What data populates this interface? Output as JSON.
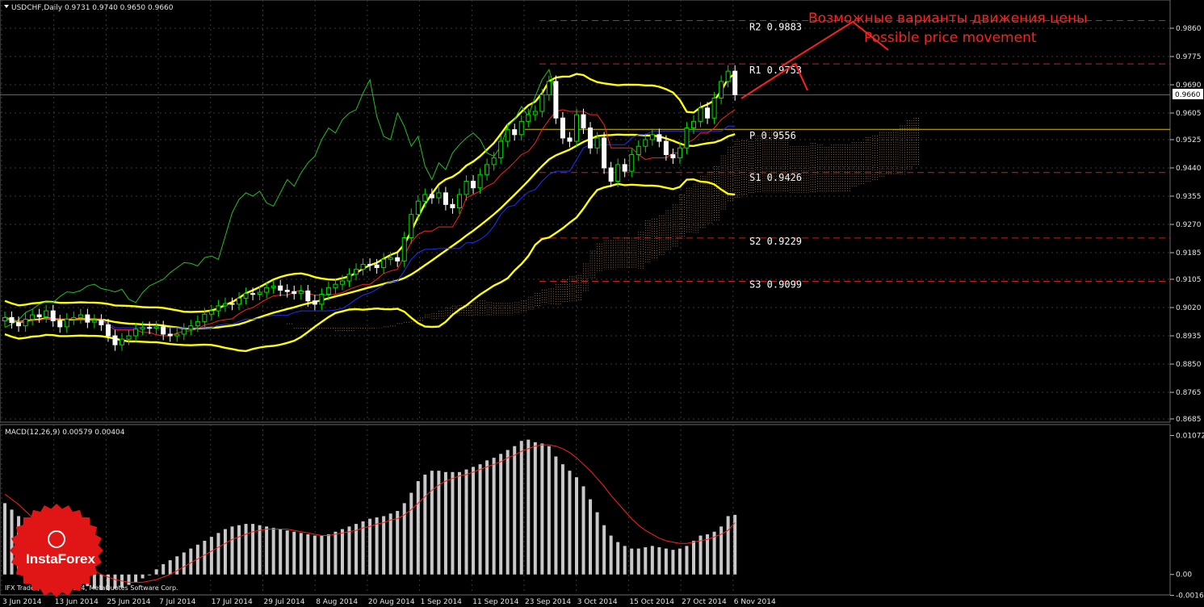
{
  "chart_data": [
    {
      "type": "candlestick",
      "symbol_header": "USDCHF,Daily  0.9731 0.9740 0.9650 0.9660",
      "current_price": "0.9660",
      "y_ticks": [
        "0.9860",
        "0.9775",
        "0.9690",
        "0.9605",
        "0.9525",
        "0.9440",
        "0.9355",
        "0.9270",
        "0.9185",
        "0.9105",
        "0.9020",
        "0.8935",
        "0.8850",
        "0.8765",
        "0.8685"
      ],
      "ylim": [
        0.868,
        0.9895
      ],
      "x_labels": [
        "3 Jun 2014",
        "13 Jun 2014",
        "25 Jun 2014",
        "7 Jul 2014",
        "17 Jul 2014",
        "29 Jul 2014",
        "8 Aug 2014",
        "20 Aug 2014",
        "1 Sep 2014",
        "11 Sep 2014",
        "23 Sep 2014",
        "3 Oct 2014",
        "15 Oct 2014",
        "27 Oct 2014",
        "6 Nov 2014"
      ],
      "pivot_levels": [
        {
          "name": "R2",
          "value": 0.9883,
          "label": "R2  0.9883"
        },
        {
          "name": "R1",
          "value": 0.9753,
          "label": "R1  0.9753"
        },
        {
          "name": "P",
          "value": 0.9556,
          "label": "P  0.9556"
        },
        {
          "name": "S1",
          "value": 0.9426,
          "label": "S1  0.9426"
        },
        {
          "name": "S2",
          "value": 0.9229,
          "label": "S2  0.9229"
        },
        {
          "name": "S3",
          "value": 0.9099,
          "label": "S3  0.9099"
        }
      ],
      "annotation_ru": "Возможные варианты движения цены",
      "annotation_en": "Possible price movement",
      "colors": {
        "bull": "#00dd00",
        "bear": "#ffffff",
        "bollinger": "#ffff00",
        "tenkan": "#ff2020",
        "kijun": "#2030ff",
        "chikou": "#20c020",
        "cloud": "#c89060",
        "pivot": "#c82020",
        "pivot_p": "#d8c000",
        "arrow": "#ff2020"
      },
      "closes": [
        0.899,
        0.8975,
        0.8965,
        0.8985,
        0.8998,
        0.8992,
        0.901,
        0.898,
        0.8962,
        0.8985,
        0.899,
        0.8998,
        0.8976,
        0.8982,
        0.8968,
        0.8935,
        0.8908,
        0.8925,
        0.8935,
        0.8955,
        0.896,
        0.8958,
        0.8962,
        0.894,
        0.8935,
        0.894,
        0.8955,
        0.8965,
        0.8978,
        0.9,
        0.901,
        0.9025,
        0.9032,
        0.903,
        0.9048,
        0.9062,
        0.906,
        0.9066,
        0.908,
        0.9085,
        0.9072,
        0.9068,
        0.9062,
        0.907,
        0.904,
        0.903,
        0.906,
        0.908,
        0.909,
        0.91,
        0.912,
        0.9135,
        0.915,
        0.9148,
        0.914,
        0.9165,
        0.917,
        0.916,
        0.923,
        0.93,
        0.934,
        0.936,
        0.935,
        0.9365,
        0.933,
        0.932,
        0.936,
        0.94,
        0.938,
        0.942,
        0.945,
        0.947,
        0.952,
        0.9555,
        0.954,
        0.958,
        0.96,
        0.961,
        0.966,
        0.97,
        0.959,
        0.953,
        0.952,
        0.96,
        0.956,
        0.95,
        0.953,
        0.944,
        0.94,
        0.945,
        0.943,
        0.948,
        0.9505,
        0.9525,
        0.954,
        0.952,
        0.948,
        0.947,
        0.95,
        0.956,
        0.958,
        0.962,
        0.959,
        0.965,
        0.97,
        0.9731,
        0.966
      ],
      "macd": {
        "label": "MACD(12,26,9) 0.00579 0.00404",
        "ylim": [
          -0.0012,
          0.011
        ],
        "y_ticks": [
          "0.01072",
          "0.00",
          "-0.00161"
        ],
        "values": [
          0.0055,
          0.005,
          0.0045,
          0.004,
          0.0033,
          0.0027,
          0.002,
          0.0014,
          0.0008,
          0.0003,
          -0.0001,
          -0.0005,
          -0.0009,
          -0.0011,
          -0.0012,
          -0.0012,
          -0.0011,
          -0.001,
          -0.0008,
          -0.0006,
          -0.0003,
          0.0,
          0.0004,
          0.0008,
          0.0011,
          0.0014,
          0.0017,
          0.002,
          0.0023,
          0.0026,
          0.0029,
          0.0032,
          0.0035,
          0.0037,
          0.0038,
          0.0039,
          0.0039,
          0.0038,
          0.0037,
          0.0036,
          0.0035,
          0.0034,
          0.0033,
          0.0032,
          0.0031,
          0.003,
          0.003,
          0.0031,
          0.0033,
          0.0035,
          0.0037,
          0.0039,
          0.0041,
          0.0043,
          0.0044,
          0.0045,
          0.0047,
          0.0049,
          0.0055,
          0.0063,
          0.0072,
          0.0077,
          0.008,
          0.008,
          0.0079,
          0.0079,
          0.0079,
          0.0081,
          0.0083,
          0.0085,
          0.0088,
          0.009,
          0.0093,
          0.0096,
          0.0099,
          0.0103,
          0.0104,
          0.0102,
          0.0101,
          0.0099,
          0.0091,
          0.0085,
          0.008,
          0.0075,
          0.0068,
          0.0058,
          0.0048,
          0.0038,
          0.003,
          0.0025,
          0.0022,
          0.002,
          0.002,
          0.0021,
          0.0022,
          0.0021,
          0.002,
          0.0019,
          0.002,
          0.0022,
          0.0026,
          0.003,
          0.0031,
          0.0033,
          0.0037,
          0.0045,
          0.0046
        ],
        "signal": [
          0.0062,
          0.0058,
          0.0054,
          0.0049,
          0.0044,
          0.0039,
          0.0033,
          0.0028,
          0.0023,
          0.0018,
          0.0014,
          0.001,
          0.0006,
          0.0003,
          0.0,
          -0.0002,
          -0.0004,
          -0.0005,
          -0.0006,
          -0.0006,
          -0.0006,
          -0.0005,
          -0.0004,
          -0.0002,
          0.0,
          0.0003,
          0.0006,
          0.0009,
          0.0012,
          0.0015,
          0.0018,
          0.0021,
          0.0024,
          0.0027,
          0.0029,
          0.0031,
          0.0033,
          0.0034,
          0.0035,
          0.0035,
          0.0035,
          0.0035,
          0.0034,
          0.0033,
          0.0032,
          0.0031,
          0.003,
          0.003,
          0.0031,
          0.0032,
          0.0033,
          0.0034,
          0.0036,
          0.0037,
          0.0039,
          0.004,
          0.0042,
          0.0043,
          0.0046,
          0.005,
          0.0055,
          0.006,
          0.0065,
          0.0069,
          0.0072,
          0.0074,
          0.0076,
          0.0077,
          0.0079,
          0.0081,
          0.0083,
          0.0085,
          0.0087,
          0.009,
          0.0092,
          0.0095,
          0.0097,
          0.0099,
          0.01,
          0.01,
          0.0099,
          0.0097,
          0.0094,
          0.009,
          0.0085,
          0.008,
          0.0074,
          0.0068,
          0.0061,
          0.0055,
          0.0049,
          0.0043,
          0.0038,
          0.0034,
          0.0031,
          0.0028,
          0.0026,
          0.0025,
          0.0024,
          0.0024,
          0.0025,
          0.0026,
          0.0027,
          0.0029,
          0.0031,
          0.0034,
          0.004
        ]
      },
      "footer": "IFX Trader, © 2001-2014, MetaQuotes Software Corp.",
      "brand": "InstaForex"
    }
  ]
}
